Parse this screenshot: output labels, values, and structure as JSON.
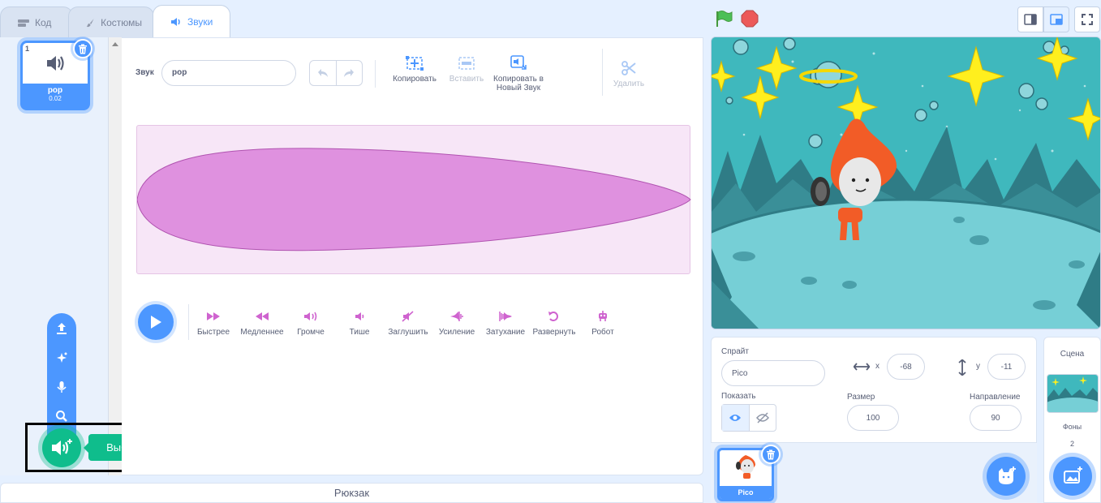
{
  "tabs": [
    {
      "label": "Код",
      "icon": "code-icon"
    },
    {
      "label": "Костюмы",
      "icon": "brush-icon"
    },
    {
      "label": "Звуки",
      "icon": "sound-icon"
    }
  ],
  "sound_list": {
    "items": [
      {
        "index": "1",
        "name": "pop",
        "duration": "0.02"
      }
    ]
  },
  "add_sound": {
    "tooltip": "Выбрать звук"
  },
  "editor": {
    "sound_label": "Звук",
    "sound_name": "pop",
    "tools": {
      "copy": "Копировать",
      "paste": "Вставить",
      "copy_new_line1": "Копировать в",
      "copy_new_line2": "Новый Звук",
      "delete": "Удалить"
    },
    "effects": [
      "Быстрее",
      "Медленнее",
      "Громче",
      "Тише",
      "Заглушить",
      "Усиление",
      "Затухание",
      "Развернуть",
      "Робот"
    ]
  },
  "backpack": {
    "label": "Рюкзак"
  },
  "sprite_info": {
    "sprite_label": "Спрайт",
    "sprite_name": "Pico",
    "x_label": "x",
    "x": "-68",
    "y_label": "y",
    "y": "-11",
    "show_label": "Показать",
    "size_label": "Размер",
    "size": "100",
    "direction_label": "Направление",
    "direction": "90"
  },
  "sprites": [
    {
      "name": "Pico"
    }
  ],
  "scene": {
    "title": "Сцена",
    "backdrops_label": "Фоны",
    "backdrops_count": "2"
  },
  "colors": {
    "accent": "#4c97ff",
    "sound_pink": "#cf63cf",
    "green": "#0fbd8c"
  }
}
